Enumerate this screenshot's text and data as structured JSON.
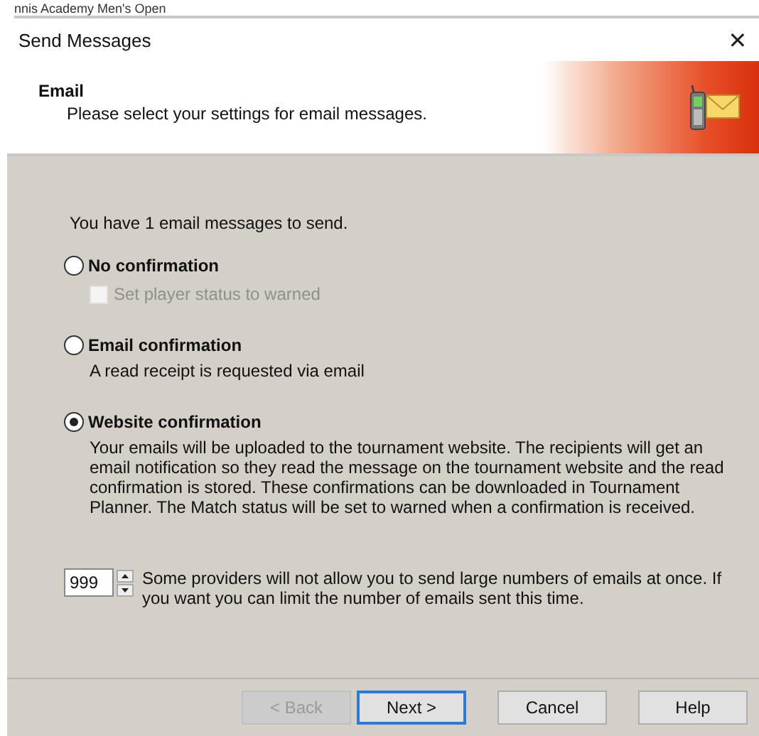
{
  "background_window": {
    "title": "nnis Academy Men's Open"
  },
  "window": {
    "title": "Send Messages",
    "close": "✕"
  },
  "header": {
    "title": "Email",
    "subtitle": "Please select your settings for email messages."
  },
  "summary": "You have 1 email messages to send.",
  "options": [
    {
      "label": "No confirmation",
      "selected": false,
      "checkbox": {
        "label": "Set player status to warned",
        "checked": false,
        "disabled": true
      }
    },
    {
      "label": "Email confirmation",
      "selected": false,
      "description": "A read receipt is requested via email"
    },
    {
      "label": "Website confirmation",
      "selected": true,
      "description": "Your emails will be uploaded to the tournament website. The recipients will get an email notification so they read the message on the tournament website and the read confirmation is stored. These confirmations can be downloaded in Tournament Planner. The Match status will be set to warned when a confirmation is received."
    }
  ],
  "limit": {
    "value": "999",
    "note": "Some providers will not allow you to send large numbers of emails at once. If you want you can limit the number of emails sent this time."
  },
  "buttons": [
    {
      "label": "< Back",
      "disabled": true,
      "default": false
    },
    {
      "label": "Next >",
      "disabled": false,
      "default": true
    },
    {
      "label": "Cancel",
      "disabled": false,
      "default": false
    },
    {
      "label": "Help",
      "disabled": false,
      "default": false
    }
  ]
}
